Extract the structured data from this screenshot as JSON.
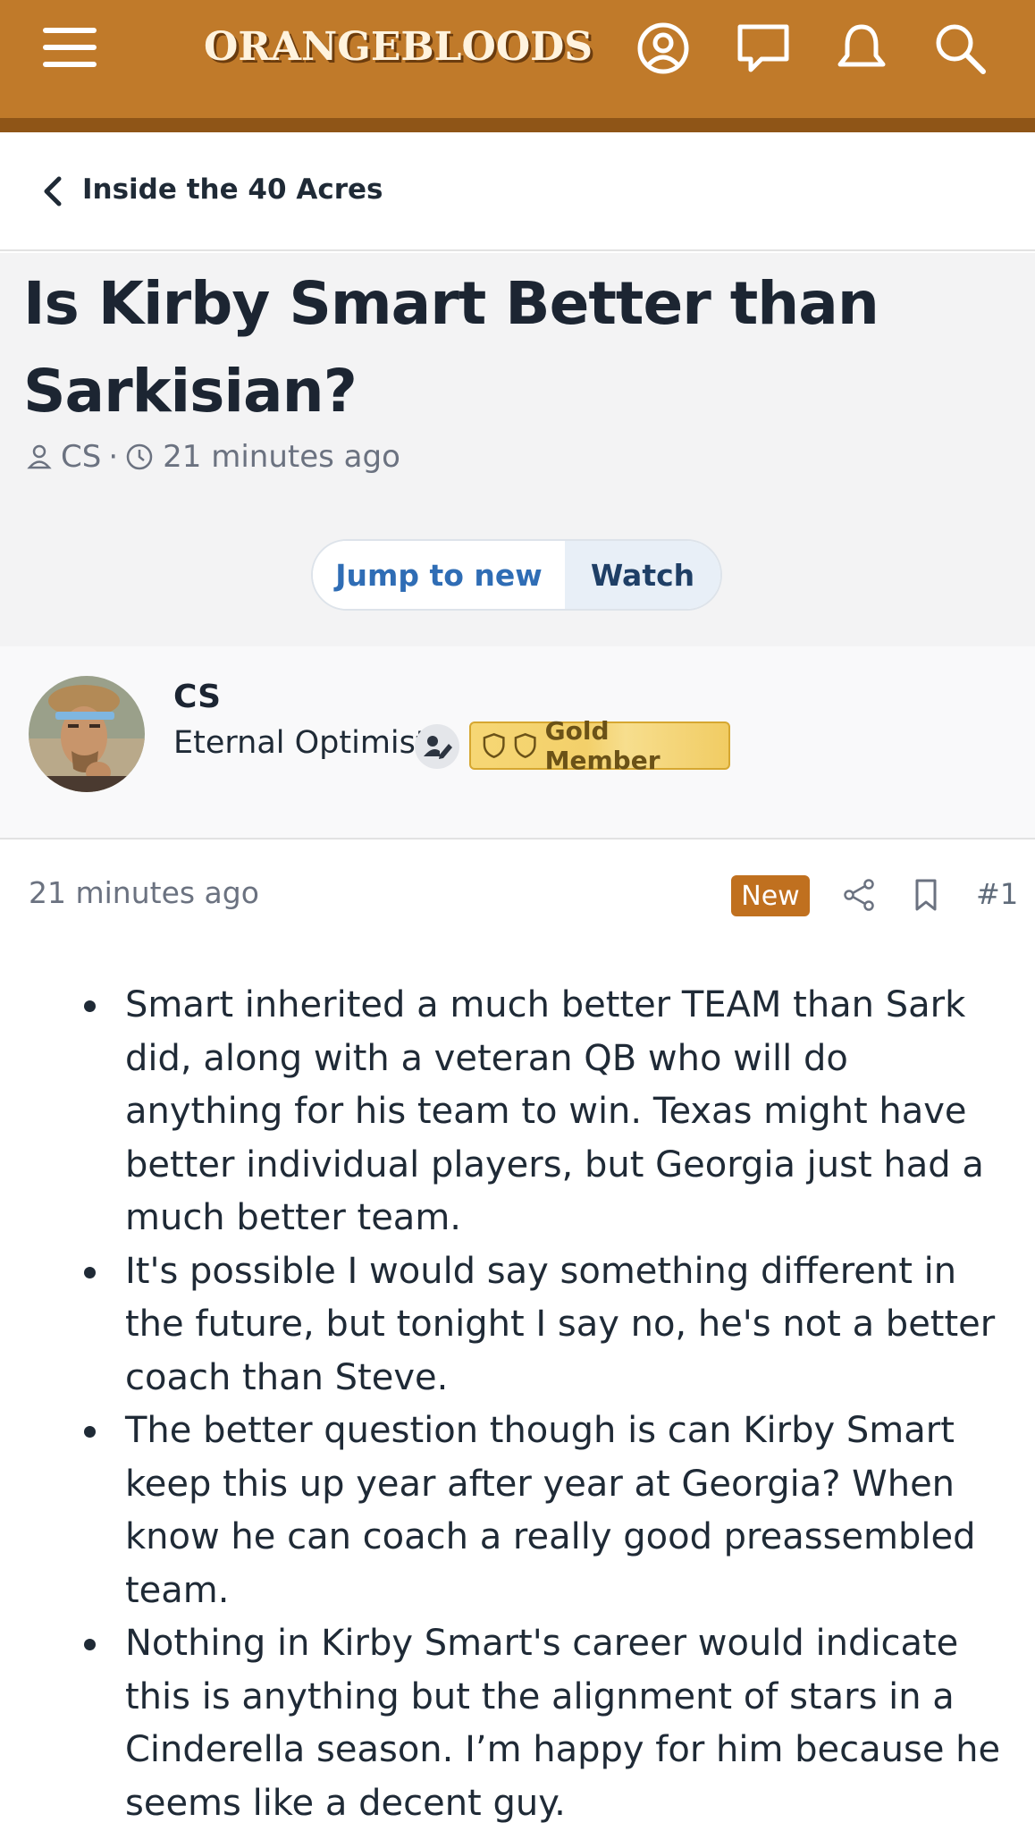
{
  "header": {
    "logo_text": "ORANGEBLOODS",
    "brand_color": "#c07a2a",
    "icons": [
      "menu-icon",
      "account-icon",
      "chat-icon",
      "notifications-icon",
      "search-icon"
    ]
  },
  "breadcrumb": {
    "label": "Inside the 40 Acres"
  },
  "thread": {
    "title": "Is Kirby Smart Better than Sarkisian?",
    "author": "CS",
    "separator": "·",
    "time": "21 minutes ago",
    "jump_label": "Jump to new",
    "watch_label": "Watch"
  },
  "user": {
    "name": "CS",
    "title": "Eternal Optimist",
    "badge": "Gold Member"
  },
  "post": {
    "time": "21 minutes ago",
    "new_label": "New",
    "number": "#1",
    "bullets": [
      "Smart inherited a much better TEAM than Sark did, along with a veteran QB who will do anything for his team to win. Texas might have better individual players, but Georgia just had a much better team.",
      "It's possible I would say something different in the future, but tonight I say no, he's not a better coach than Steve.",
      "The better question though is can Kirby Smart keep this up year after year at Georgia? When know he can coach a really good preassembled team.",
      "Nothing in Kirby Smart's career would indicate this is anything but the alignment of stars in a Cinderella season. I’m happy for him because he seems like a decent guy."
    ]
  }
}
